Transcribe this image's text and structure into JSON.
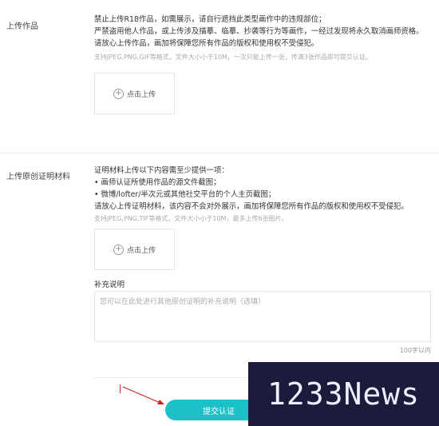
{
  "section1": {
    "label": "上传作品",
    "rules": [
      "禁止上传R18作品，如需展示，请自行遮挡此类型画作中的违规部位；",
      "严禁盗用他人作品，或上传涉及描摹、临摹、抄袭等行为等画作，一经过发现将永久取消画师资格。",
      "请放心上传作品，画加将保障您所有作品的版权和使用权不受侵犯。"
    ],
    "hint": "支持JPEG,PNG,GIF等格式，文件大小小于10M，一次只能上传一张，传满3张作品即可提交认证。",
    "upload_label": "点击上传"
  },
  "section2": {
    "label": "上传原创证明材料",
    "rules": [
      "证明材料上传以下内容需至少提供一项：",
      "• 画师认证所使用作品的源文件截图；",
      "• 微博/lofter/半次元或其他社交平台的个人主页截图；",
      "请放心上传证明材料，该内容不会对外展示，画加将保障您所有作品的版权和使用权不受侵犯。"
    ],
    "hint": "支持JPEG,PNG,TIF等格式，文件大小小于10M，最多上传6张图片。",
    "upload_label": "点击上传",
    "supplement_title": "补充说明",
    "supplement_placeholder": "您可以在此处进行其他原创证明的补充说明（选填）",
    "counter": "100字以内"
  },
  "submit_label": "提交认证",
  "watermark": "1233News",
  "colors": {
    "accent": "#1ec0c8",
    "arrow": "#d22222",
    "watermark_bg": "#1b1b3c"
  }
}
